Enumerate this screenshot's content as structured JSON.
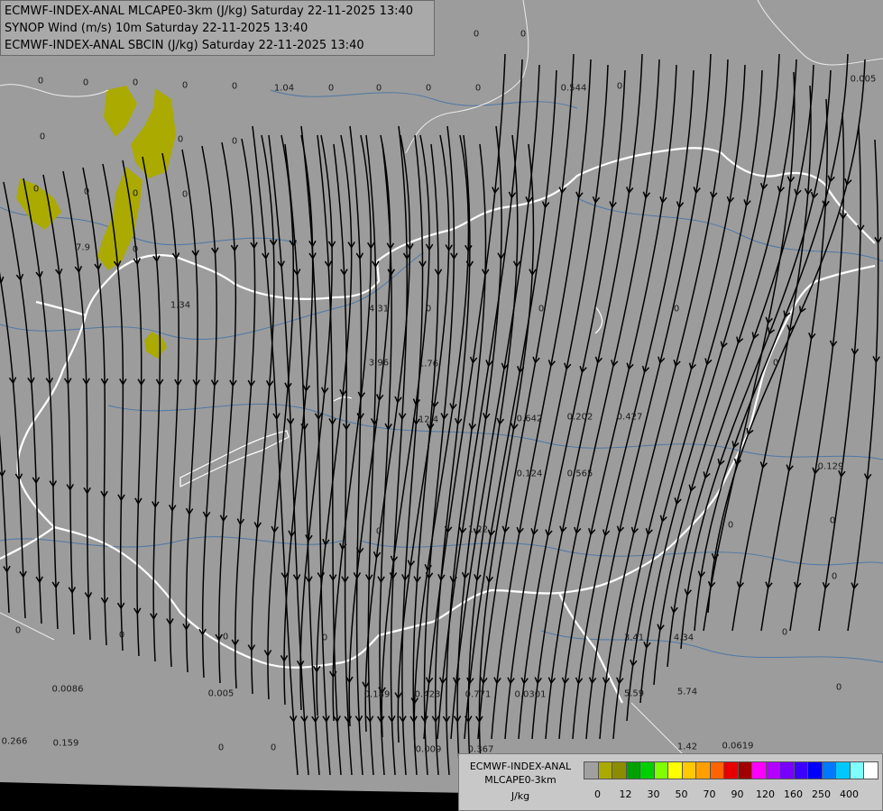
{
  "header": {
    "line1": "ECMWF-INDEX-ANAL MLCAPE0-3km (J/kg) Saturday 22-11-2025 13:40",
    "line2": "SYNOP Wind (m/s) 10m Saturday 22-11-2025 13:40",
    "line3": "ECMWF-INDEX-ANAL SBCIN (J/kg) Saturday 22-11-2025 13:40"
  },
  "legend": {
    "title_line1": "ECMWF-INDEX-ANAL",
    "title_line2": "MLCAPE0-3km",
    "unit": "J/kg",
    "colors": [
      "#a0a0a0",
      "#a9a900",
      "#8c8c00",
      "#00a000",
      "#00d000",
      "#80ff00",
      "#ffff00",
      "#ffc800",
      "#ffa000",
      "#ff6400",
      "#e60000",
      "#a00000",
      "#ff00ff",
      "#b400ff",
      "#7800ff",
      "#3c00ff",
      "#0000ff",
      "#0078ff",
      "#00c8ff",
      "#80ffff",
      "#ffffff"
    ],
    "ticks": [
      "0",
      "12",
      "30",
      "50",
      "70",
      "90",
      "120",
      "160",
      "250",
      "400"
    ]
  },
  "station_values": [
    {
      "v": "0"
    },
    {
      "v": "0"
    },
    {
      "v": "0"
    },
    {
      "v": "0"
    },
    {
      "v": "0"
    },
    {
      "v": "0"
    },
    {
      "v": "1.04"
    },
    {
      "v": "0"
    },
    {
      "v": "0"
    },
    {
      "v": "0"
    },
    {
      "v": "0"
    },
    {
      "v": "0.544"
    },
    {
      "v": "0"
    },
    {
      "v": "0.005"
    },
    {
      "v": "0"
    },
    {
      "v": "0"
    },
    {
      "v": "0"
    },
    {
      "v": "0"
    },
    {
      "v": "0"
    },
    {
      "v": "0"
    },
    {
      "v": "7.9"
    },
    {
      "v": "0"
    },
    {
      "v": "1.34"
    },
    {
      "v": "4.31"
    },
    {
      "v": "0"
    },
    {
      "v": "3.96"
    },
    {
      "v": "1.76"
    },
    {
      "v": "12.4"
    },
    {
      "v": "0.642"
    },
    {
      "v": "0.202"
    },
    {
      "v": "0.427"
    },
    {
      "v": "0.124"
    },
    {
      "v": "0.565"
    },
    {
      "v": "0.129"
    },
    {
      "v": "1.22"
    },
    {
      "v": "0"
    },
    {
      "v": "3.41"
    },
    {
      "v": "4.34"
    },
    {
      "v": "5.59"
    },
    {
      "v": "5.74"
    },
    {
      "v": "0.0086"
    },
    {
      "v": "0.005"
    },
    {
      "v": "0.189"
    },
    {
      "v": "0.423"
    },
    {
      "v": "0.771"
    },
    {
      "v": "0.0301"
    },
    {
      "v": "0.266"
    },
    {
      "v": "0.159"
    },
    {
      "v": "0.009"
    },
    {
      "v": "0.367"
    },
    {
      "v": "1.42"
    },
    {
      "v": "0.0619"
    },
    {
      "v": "0"
    },
    {
      "v": "0"
    },
    {
      "v": "0"
    },
    {
      "v": "0"
    },
    {
      "v": "0"
    },
    {
      "v": "0"
    },
    {
      "v": "0"
    },
    {
      "v": "0"
    },
    {
      "v": "0"
    },
    {
      "v": "0"
    },
    {
      "v": "0"
    },
    {
      "v": "0"
    },
    {
      "v": "0"
    },
    {
      "v": "0"
    },
    {
      "v": "0"
    },
    {
      "v": "0"
    },
    {
      "v": "0"
    },
    {
      "v": "0"
    }
  ]
}
